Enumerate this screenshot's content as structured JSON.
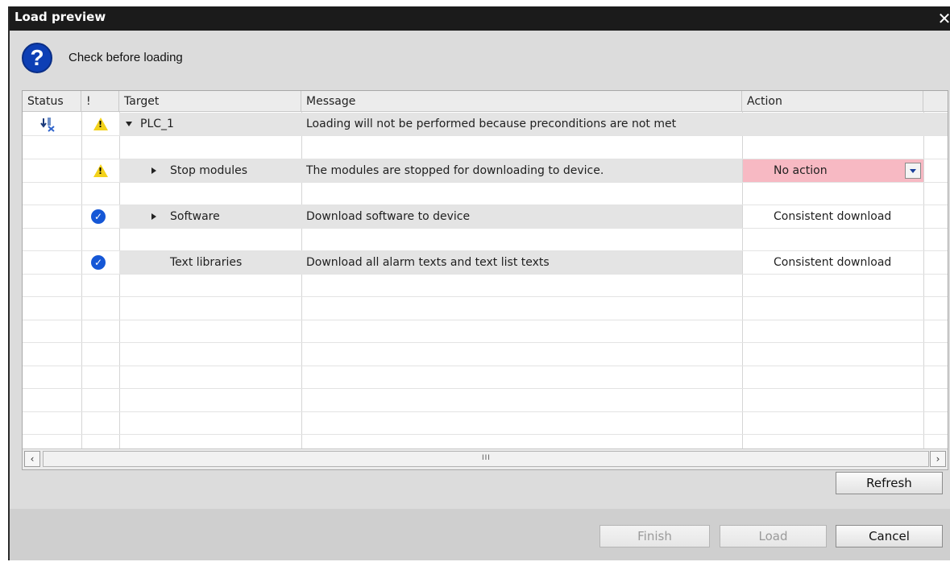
{
  "window": {
    "title": "Load preview",
    "close": "✕"
  },
  "header": {
    "icon": "question-icon",
    "text": "Check before loading"
  },
  "table": {
    "columns": [
      "Status",
      "!",
      "Target",
      "Message",
      "Action"
    ],
    "rows": [
      {
        "target": "PLC_1",
        "message": "Loading will not be performed because preconditions are not met",
        "action": ""
      },
      {
        "target": "Stop modules",
        "message": "The modules are stopped for downloading to device.",
        "action": "No action"
      },
      {
        "target": "Software",
        "message": "Download software to device",
        "action": "Consistent download"
      },
      {
        "target": "Text libraries",
        "message": "Download all alarm texts and text list texts",
        "action": "Consistent download"
      }
    ],
    "scroll_grip": "III"
  },
  "buttons": {
    "refresh": "Refresh",
    "finish": "Finish",
    "load": "Load",
    "cancel": "Cancel"
  },
  "colors": {
    "title_bar": "#1b1b1b",
    "question_icon": "#0d3fb5",
    "warning": "#f3d21b",
    "ok": "#1557d6",
    "no_action_bg": "#f7b9c3"
  }
}
